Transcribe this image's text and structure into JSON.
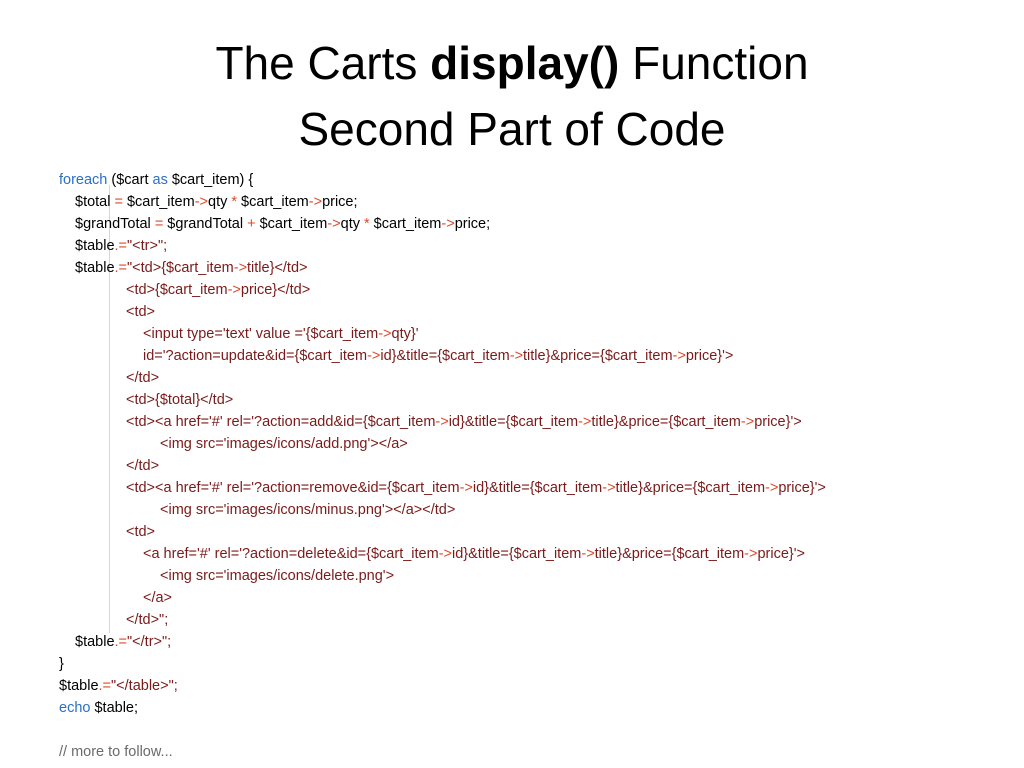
{
  "title": {
    "line1_prefix": "The Carts ",
    "line1_bold": "display()",
    "line1_suffix": " Function",
    "line2": "Second Part of Code"
  },
  "colors": {
    "keyword": "#2b6fc7",
    "operator": "#e04a2a",
    "string": "#7a1a1a",
    "text": "#000000",
    "comment": "#6a6a6a"
  },
  "code": [
    {
      "indent": 0,
      "tokens": [
        {
          "t": "foreach",
          "c": "kw"
        },
        {
          "t": " ($cart ",
          "c": "var"
        },
        {
          "t": "as",
          "c": "kw"
        },
        {
          "t": " $cart_item) {",
          "c": "var"
        }
      ]
    },
    {
      "indent": 16,
      "tokens": [
        {
          "t": "$total ",
          "c": "var"
        },
        {
          "t": "=",
          "c": "op"
        },
        {
          "t": " $cart_item",
          "c": "var"
        },
        {
          "t": "->",
          "c": "op"
        },
        {
          "t": "qty ",
          "c": "var"
        },
        {
          "t": "*",
          "c": "op"
        },
        {
          "t": " $cart_item",
          "c": "var"
        },
        {
          "t": "->",
          "c": "op"
        },
        {
          "t": "price;",
          "c": "var"
        }
      ]
    },
    {
      "indent": 16,
      "tokens": [
        {
          "t": "$grandTotal ",
          "c": "var"
        },
        {
          "t": "=",
          "c": "op"
        },
        {
          "t": " $grandTotal ",
          "c": "var"
        },
        {
          "t": "+",
          "c": "op"
        },
        {
          "t": " $cart_item",
          "c": "var"
        },
        {
          "t": "->",
          "c": "op"
        },
        {
          "t": "qty ",
          "c": "var"
        },
        {
          "t": "*",
          "c": "op"
        },
        {
          "t": " $cart_item",
          "c": "var"
        },
        {
          "t": "->",
          "c": "op"
        },
        {
          "t": "price;",
          "c": "var"
        }
      ]
    },
    {
      "indent": 16,
      "tokens": [
        {
          "t": "$table",
          "c": "var"
        },
        {
          "t": ".=",
          "c": "op"
        },
        {
          "t": "\"<tr>\";",
          "c": "str"
        }
      ]
    },
    {
      "indent": 16,
      "tokens": [
        {
          "t": "$table",
          "c": "var"
        },
        {
          "t": ".=",
          "c": "op"
        },
        {
          "t": "\"<td>{$cart_item",
          "c": "str"
        },
        {
          "t": "->",
          "c": "op"
        },
        {
          "t": "title}</td>",
          "c": "str"
        }
      ]
    },
    {
      "indent": 67,
      "tokens": [
        {
          "t": "<td>{$cart_item",
          "c": "str"
        },
        {
          "t": "->",
          "c": "op"
        },
        {
          "t": "price}</td>",
          "c": "str"
        }
      ]
    },
    {
      "indent": 67,
      "tokens": [
        {
          "t": "<td>",
          "c": "str"
        }
      ]
    },
    {
      "indent": 84,
      "tokens": [
        {
          "t": "<input type='text' value ='{$cart_item",
          "c": "str"
        },
        {
          "t": "->",
          "c": "op"
        },
        {
          "t": "qty}'",
          "c": "str"
        }
      ]
    },
    {
      "indent": 84,
      "tokens": [
        {
          "t": "id='?action=update&id={$cart_item",
          "c": "str"
        },
        {
          "t": "->",
          "c": "op"
        },
        {
          "t": "id}&title={$cart_item",
          "c": "str"
        },
        {
          "t": "->",
          "c": "op"
        },
        {
          "t": "title}&price={$cart_item",
          "c": "str"
        },
        {
          "t": "->",
          "c": "op"
        },
        {
          "t": "price}'>",
          "c": "str"
        }
      ]
    },
    {
      "indent": 67,
      "tokens": [
        {
          "t": "</td>",
          "c": "str"
        }
      ]
    },
    {
      "indent": 67,
      "tokens": [
        {
          "t": "<td>{$total}</td>",
          "c": "str"
        }
      ]
    },
    {
      "indent": 67,
      "tokens": [
        {
          "t": "<td><a href='#' rel='?action=add&id={$cart_item",
          "c": "str"
        },
        {
          "t": "->",
          "c": "op"
        },
        {
          "t": "id}&title={$cart_item",
          "c": "str"
        },
        {
          "t": "->",
          "c": "op"
        },
        {
          "t": "title}&price={$cart_item",
          "c": "str"
        },
        {
          "t": "->",
          "c": "op"
        },
        {
          "t": "price}'>",
          "c": "str"
        }
      ]
    },
    {
      "indent": 101,
      "tokens": [
        {
          "t": "<img src='images/icons/add.png'></a>",
          "c": "str"
        }
      ]
    },
    {
      "indent": 67,
      "tokens": [
        {
          "t": "</td>",
          "c": "str"
        }
      ]
    },
    {
      "indent": 67,
      "tokens": [
        {
          "t": "<td><a href='#' rel='?action=remove&id={$cart_item",
          "c": "str"
        },
        {
          "t": "->",
          "c": "op"
        },
        {
          "t": "id}&title={$cart_item",
          "c": "str"
        },
        {
          "t": "->",
          "c": "op"
        },
        {
          "t": "title}&price={$cart_item",
          "c": "str"
        },
        {
          "t": "->",
          "c": "op"
        },
        {
          "t": "price}'>",
          "c": "str"
        }
      ]
    },
    {
      "indent": 101,
      "tokens": [
        {
          "t": "<img src='images/icons/minus.png'></a></td>",
          "c": "str"
        }
      ]
    },
    {
      "indent": 67,
      "tokens": [
        {
          "t": "<td>",
          "c": "str"
        }
      ]
    },
    {
      "indent": 84,
      "tokens": [
        {
          "t": "<a href='#' rel='?action=delete&id={$cart_item",
          "c": "str"
        },
        {
          "t": "->",
          "c": "op"
        },
        {
          "t": "id}&title={$cart_item",
          "c": "str"
        },
        {
          "t": "->",
          "c": "op"
        },
        {
          "t": "title}&price={$cart_item",
          "c": "str"
        },
        {
          "t": "->",
          "c": "op"
        },
        {
          "t": "price}'>",
          "c": "str"
        }
      ]
    },
    {
      "indent": 101,
      "tokens": [
        {
          "t": "<img src='images/icons/delete.png'>",
          "c": "str"
        }
      ]
    },
    {
      "indent": 84,
      "tokens": [
        {
          "t": "</a>",
          "c": "str"
        }
      ]
    },
    {
      "indent": 67,
      "tokens": [
        {
          "t": "</td>\";",
          "c": "str"
        }
      ]
    },
    {
      "indent": 16,
      "tokens": [
        {
          "t": "$table",
          "c": "var"
        },
        {
          "t": ".=",
          "c": "op"
        },
        {
          "t": "\"</tr>\";",
          "c": "str"
        }
      ]
    },
    {
      "indent": 0,
      "tokens": [
        {
          "t": "}",
          "c": "var"
        }
      ]
    },
    {
      "indent": 0,
      "tokens": [
        {
          "t": "$table",
          "c": "var"
        },
        {
          "t": ".=",
          "c": "op"
        },
        {
          "t": "\"</table>\";",
          "c": "str"
        }
      ]
    },
    {
      "indent": 0,
      "tokens": [
        {
          "t": "echo",
          "c": "kw"
        },
        {
          "t": " $table;",
          "c": "var"
        }
      ]
    },
    {
      "indent": 0,
      "tokens": []
    },
    {
      "indent": 0,
      "tokens": [
        {
          "t": "// more to follow...",
          "c": "cm"
        }
      ]
    }
  ]
}
